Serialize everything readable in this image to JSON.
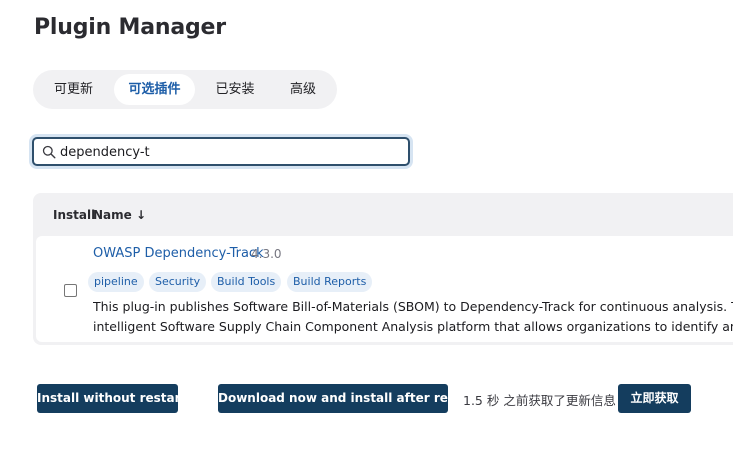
{
  "page": {
    "title": "Plugin Manager"
  },
  "tabs": [
    {
      "label": "可更新",
      "active": false
    },
    {
      "label": "可选插件",
      "active": true
    },
    {
      "label": "已安装",
      "active": false
    },
    {
      "label": "高级",
      "active": false
    }
  ],
  "search": {
    "value": "dependency-t",
    "placeholder": "",
    "icon": "search-icon"
  },
  "table": {
    "headers": {
      "install": "Install",
      "name": "Name ↓"
    },
    "rows": [
      {
        "checked": false,
        "name": "OWASP Dependency-Track",
        "version": "4.3.0",
        "tags": [
          "pipeline",
          "Security",
          "Build Tools",
          "Build Reports"
        ],
        "description_line1": "This plug-in publishes Software Bill-of-Materials (SBOM) to Dependency-Track for continuous analysis. This plugin",
        "description_line2": "intelligent Software Supply Chain Component Analysis platform that allows organizations to identify and reduce ri"
      }
    ]
  },
  "actions": {
    "install_without_restart": "Install without restart",
    "download_and_install": "Download now and install after restart",
    "status_text": "1.5 秒 之前获取了更新信息",
    "fetch_now": "立即获取"
  },
  "colors": {
    "accent": "#1e5ea8",
    "button_bg": "#143d5e",
    "tab_bar_bg": "#f1f1f3",
    "tag_bg": "#e7eff8"
  }
}
